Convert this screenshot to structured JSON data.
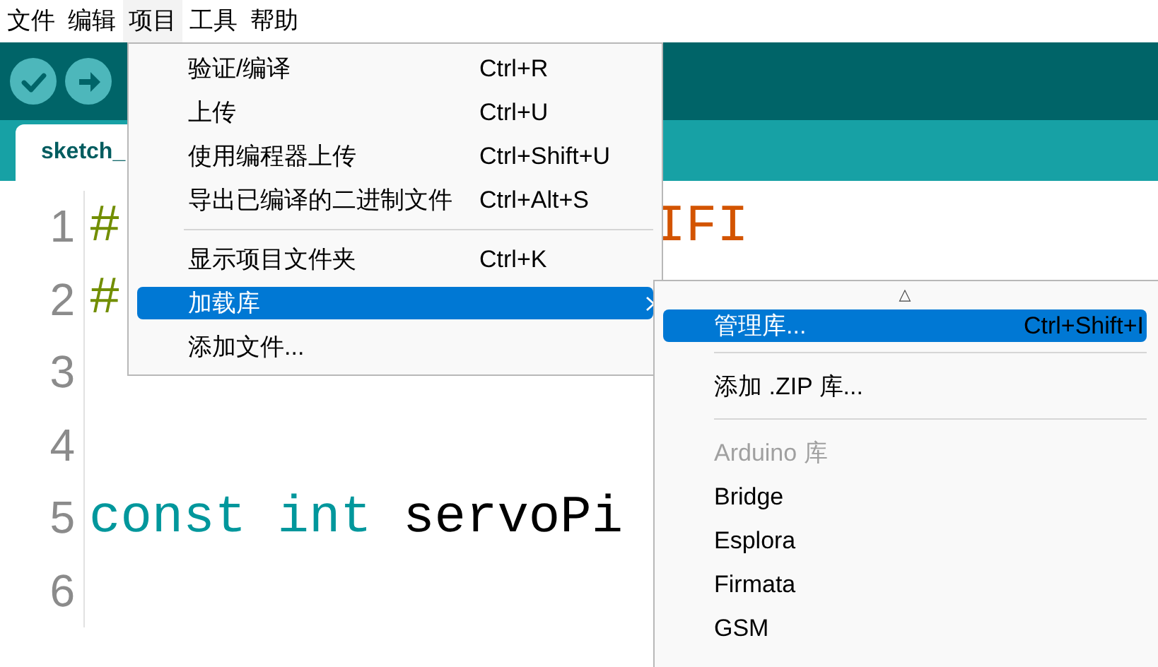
{
  "menubar": [
    {
      "label": "文件",
      "selected": false
    },
    {
      "label": "编辑",
      "selected": false
    },
    {
      "label": "项目",
      "selected": true
    },
    {
      "label": "工具",
      "selected": false
    },
    {
      "label": "帮助",
      "selected": false
    }
  ],
  "toolbar": {
    "buttons": [
      {
        "kind": "verify"
      },
      {
        "kind": "upload"
      }
    ]
  },
  "tabs": [
    {
      "label": "sketch_",
      "selected": true
    }
  ],
  "editor": {
    "lines": [
      {
        "number": "1",
        "tokens": [
          {
            "text": "#",
            "kind": "directive"
          },
          {
            "text": "                 IFI",
            "kind": "string"
          }
        ]
      },
      {
        "number": "2",
        "tokens": [
          {
            "text": "#",
            "kind": "directive"
          }
        ]
      },
      {
        "number": "3"
      },
      {
        "number": "4"
      },
      {
        "number": "5",
        "tokens": [
          {
            "text": "const",
            "kind": "keyword"
          },
          {
            "text": " int",
            "kind": "keyword"
          },
          {
            "text": " servoPi",
            "kind": "plain"
          }
        ]
      },
      {
        "number": "6"
      }
    ]
  },
  "menu": {
    "items": [
      {
        "kind": "item",
        "label": "验证/编译",
        "shortcut": "Ctrl+R",
        "selected": false
      },
      {
        "kind": "item",
        "label": "上传",
        "shortcut": "Ctrl+U",
        "selected": false
      },
      {
        "kind": "item",
        "label": "使用编程器上传",
        "shortcut": "Ctrl+Shift+U",
        "selected": false
      },
      {
        "kind": "item",
        "label": "导出已编译的二进制文件",
        "shortcut": "Ctrl+Alt+S",
        "selected": false
      },
      {
        "kind": "separator"
      },
      {
        "kind": "item",
        "label": "显示项目文件夹",
        "shortcut": "Ctrl+K",
        "selected": false
      },
      {
        "kind": "submenu",
        "label": "加载库",
        "selected": true
      },
      {
        "kind": "item",
        "label": "添加文件...",
        "selected": false
      }
    ]
  },
  "submenu": {
    "scroll_up": "△",
    "items": [
      {
        "kind": "item",
        "label": "管理库...",
        "shortcut": "Ctrl+Shift+I",
        "selected": true
      },
      {
        "kind": "separator"
      },
      {
        "kind": "item",
        "label": "添加 .ZIP 库...",
        "selected": false
      },
      {
        "kind": "separator"
      },
      {
        "kind": "header",
        "label": "Arduino 库"
      },
      {
        "kind": "item",
        "label": "Bridge",
        "selected": false
      },
      {
        "kind": "item",
        "label": "Esplora",
        "selected": false
      },
      {
        "kind": "item",
        "label": "Firmata",
        "selected": false
      },
      {
        "kind": "item",
        "label": "GSM",
        "selected": false
      }
    ]
  }
}
